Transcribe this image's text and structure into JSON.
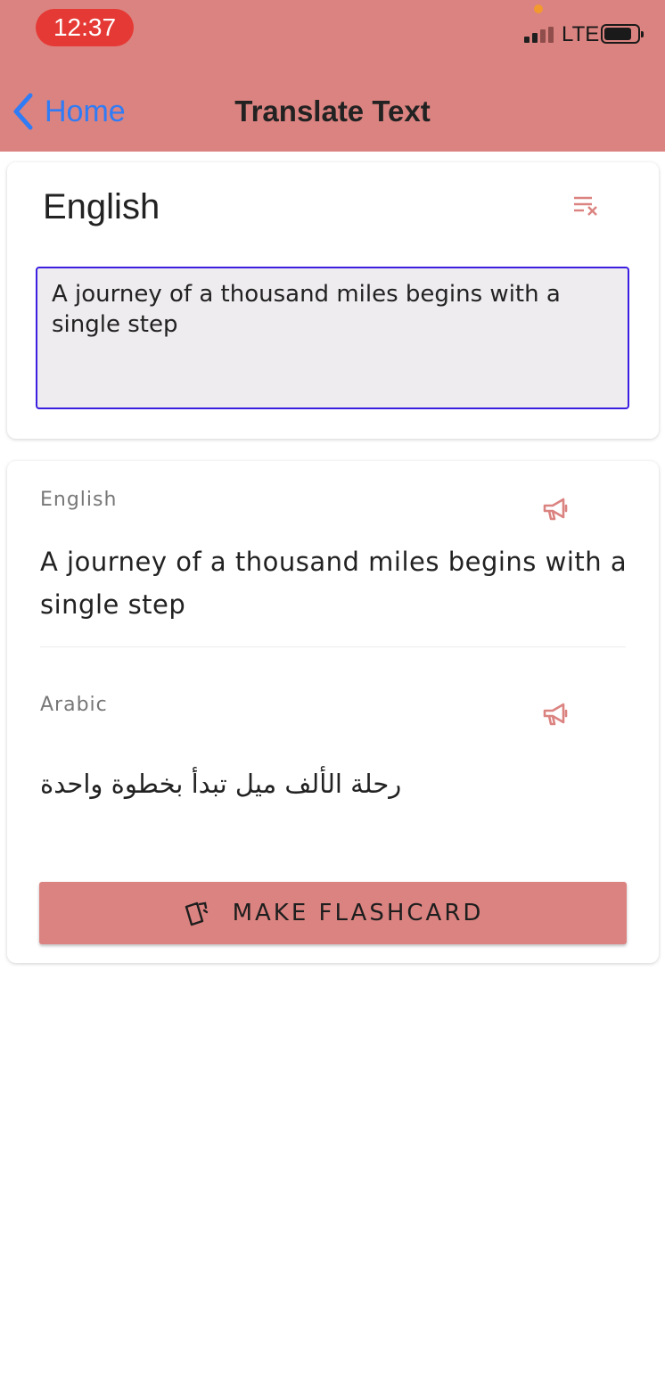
{
  "status_bar": {
    "time": "12:37",
    "network": "LTE"
  },
  "nav": {
    "back_label": "Home",
    "title": "Translate Text"
  },
  "input_card": {
    "language": "English",
    "text_value": "A journey of a thousand miles begins with a single step"
  },
  "output_card": {
    "source": {
      "language": "English",
      "text": "A journey of a thousand miles begins with a single step"
    },
    "target": {
      "language": "Arabic",
      "text": "رحلة الألف ميل تبدأ بخطوة واحدة"
    },
    "flashcard_button_label": "MAKE FLASHCARD"
  },
  "icons": {
    "back": "chevron-left-icon",
    "clear": "clear-all-icon",
    "speak": "megaphone-icon",
    "flashcard": "cards-icon"
  },
  "colors": {
    "header_bg": "#db8380",
    "accent": "#db8380",
    "link": "#2f7cf6",
    "input_border": "#3b1fe0",
    "time_pill": "#e53935"
  }
}
